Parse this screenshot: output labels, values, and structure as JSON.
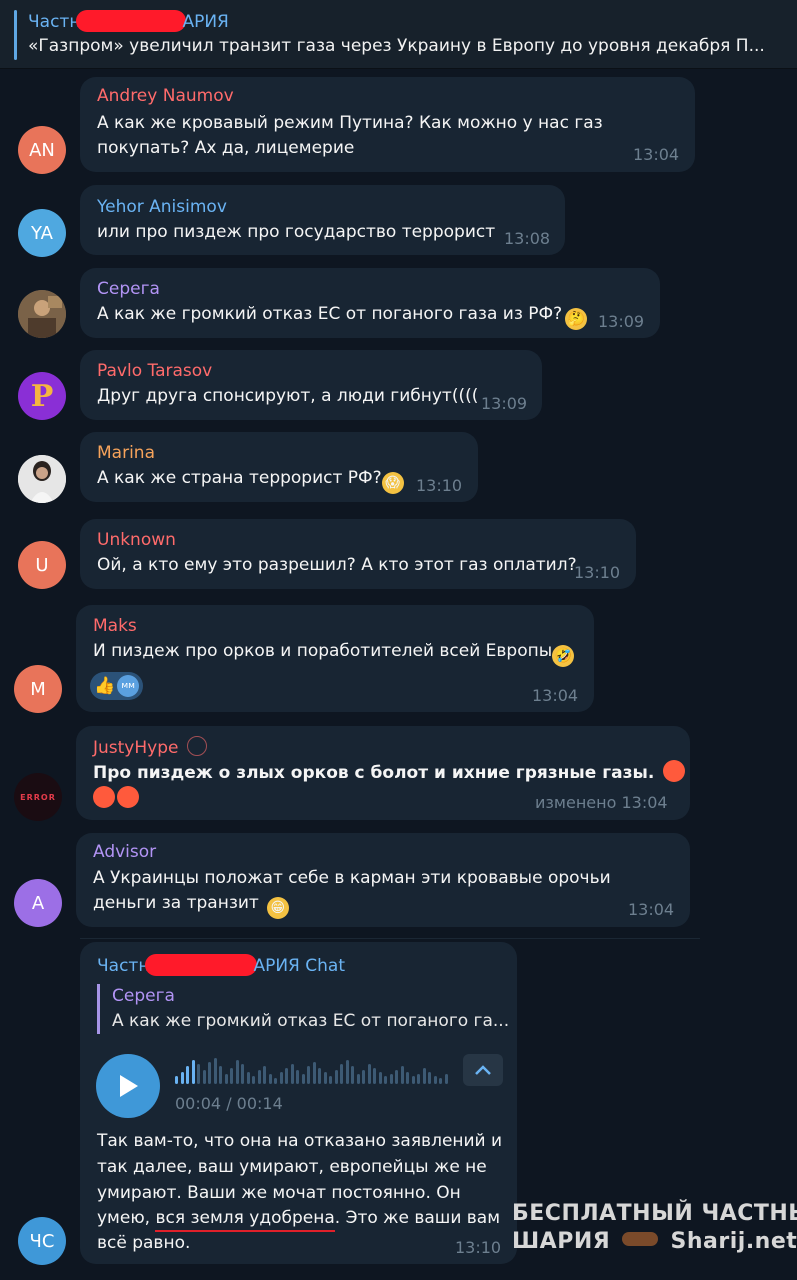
{
  "pinned": {
    "title_prefix": "Частн",
    "title_suffix": "АРИЯ",
    "text": "«Газпром» увеличил транзит газа через Украину в Европу до уровня декабря  П..."
  },
  "messages": [
    {
      "avatar": "AN",
      "avatar_color": "#e8745a",
      "sender": "Andrey Naumov",
      "sender_color": "#ff6b6b",
      "lines": [
        "А как же кровавый режим Путина? Как можно у нас газ",
        "покупать? Ах да, лицемерие"
      ],
      "time": "13:04"
    },
    {
      "avatar": "YA",
      "avatar_color": "#4fa8e0",
      "sender": "Yehor Anisimov",
      "sender_color": "#6ab3f3",
      "lines": [
        "или про пиздеж про государство террорист"
      ],
      "time": "13:08"
    },
    {
      "avatar": "",
      "avatar_color": "#6b5a4a",
      "sender": "Серега",
      "sender_color": "#b294f5",
      "lines": [
        "А как же громкий отказ ЕС от поганого газа из  РФ?"
      ],
      "emoji": "🤔",
      "time": "13:09"
    },
    {
      "avatar": "P",
      "avatar_color": "#8a2fd6",
      "sender": "Pavlo Tarasov",
      "sender_color": "#ff6b6b",
      "lines": [
        "Друг друга спонсируют, а люди гибнут(((("
      ],
      "time": "13:09"
    },
    {
      "avatar": "",
      "avatar_color": "#d9d9d9",
      "sender": "Marina",
      "sender_color": "#f6a35b",
      "lines": [
        "А как же страна террорист РФ?"
      ],
      "emoji": "😱",
      "time": "13:10"
    },
    {
      "avatar": "U",
      "avatar_color": "#e8745a",
      "sender": "Unknown",
      "sender_color": "#ff6b6b",
      "lines": [
        "Ой, а кто ему это разрешил? А кто этот газ оплатил?"
      ],
      "time": "13:10"
    },
    {
      "avatar": "M",
      "avatar_color": "#e8745a",
      "sender": "Maks",
      "sender_color": "#ff6b6b",
      "lines": [
        "И пиздеж про орков и поработителей всей Европы"
      ],
      "emoji": "🤣",
      "reaction_user": "мм",
      "time": "13:04"
    },
    {
      "avatar": "ERROR",
      "avatar_color": "#1a0c12",
      "sender": "JustyHype",
      "sender_color": "#ff6b6b",
      "lines": [
        "Про пиздеж о злых орков с болот и ихние грязные газы."
      ],
      "edited_label": "изменено",
      "time": "13:04"
    },
    {
      "avatar": "A",
      "avatar_color": "#9c6fe6",
      "sender": "Advisor",
      "sender_color": "#b294f5",
      "lines": [
        "А Украинцы положат себе в карман эти кровавые орочьи",
        "деньги за транзит"
      ],
      "emoji": "😁",
      "time": "13:04"
    }
  ],
  "voice_message": {
    "avatar": "ЧС",
    "avatar_color": "#3f98d8",
    "sender_prefix": "Частн",
    "sender_suffix": "АРИЯ Chat",
    "sender_color": "#6ab3f3",
    "reply_sender": "Серега",
    "reply_text": "А как же громкий отказ ЕС от поганого га...",
    "duration": "00:04 / 00:14",
    "transcript_lines": [
      "Так вам-то, что она на отказано заявлений и",
      "так далее, ваш умирают, европейцы же не",
      "умирают. Ваши же мочат постоянно. Он"
    ],
    "transcript_before_underline": "умею, ",
    "transcript_underlined": "вся земля удобрена",
    "transcript_after_underline": ". Это же ваши вам",
    "transcript_last": "всё равно.",
    "time": "13:10"
  },
  "watermark": {
    "line1": "БЕСПЛАТНЫЙ  ЧАСТНЫЙ",
    "line2_left": "ШАРИЯ",
    "line2_right": "Sharij.net"
  },
  "colors": {
    "background": "#0e1621",
    "bubble": "#182533",
    "accent": "#3f98d8",
    "time": "#6d7f8f"
  }
}
